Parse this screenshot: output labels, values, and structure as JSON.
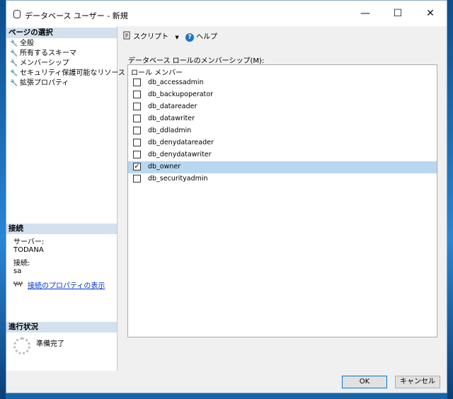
{
  "window": {
    "title": "データベース ユーザー - 新規",
    "minimize_glyph": "—",
    "maximize_glyph": "☐",
    "close_glyph": "✕"
  },
  "left_pane": {
    "select_page_header": "ページの選択",
    "pages": [
      {
        "label": "全般",
        "icon": "wrench-icon"
      },
      {
        "label": "所有するスキーマ",
        "icon": "wrench-icon"
      },
      {
        "label": "メンバーシップ",
        "icon": "wrench-icon"
      },
      {
        "label": "セキュリティ保護可能なリソース",
        "icon": "wrench-icon"
      },
      {
        "label": "拡張プロパティ",
        "icon": "wrench-icon"
      }
    ],
    "connection_header": "接続",
    "server_label": "サーバー:",
    "server_value": "TODANA",
    "connection_label": "接続:",
    "connection_value": "sa",
    "view_connection_properties_link": "接続のプロパティの表示",
    "progress_header": "進行状況",
    "progress_status": "準備完了"
  },
  "toolbar": {
    "script_label": "スクリプト",
    "dropdown_glyph": "▼",
    "help_label": "ヘルプ",
    "help_glyph": "?"
  },
  "membership": {
    "label": "データベース ロールのメンバーシップ(M):",
    "column_header": "ロール メンバー",
    "roles": [
      {
        "name": "db_accessadmin",
        "checked": false
      },
      {
        "name": "db_backupoperator",
        "checked": false
      },
      {
        "name": "db_datareader",
        "checked": false
      },
      {
        "name": "db_datawriter",
        "checked": false
      },
      {
        "name": "db_ddladmin",
        "checked": false
      },
      {
        "name": "db_denydatareader",
        "checked": false
      },
      {
        "name": "db_denydatawriter",
        "checked": false
      },
      {
        "name": "db_owner",
        "checked": true,
        "check_glyph": "✓"
      },
      {
        "name": "db_securityadmin",
        "checked": false
      }
    ]
  },
  "buttons": {
    "ok": "OK",
    "cancel": "キャンセル"
  },
  "colors": {
    "header_bg": "#d3e1ee",
    "selected_row": "#b9d7f1",
    "link": "#0033cc",
    "desktop": "#1565a8"
  }
}
